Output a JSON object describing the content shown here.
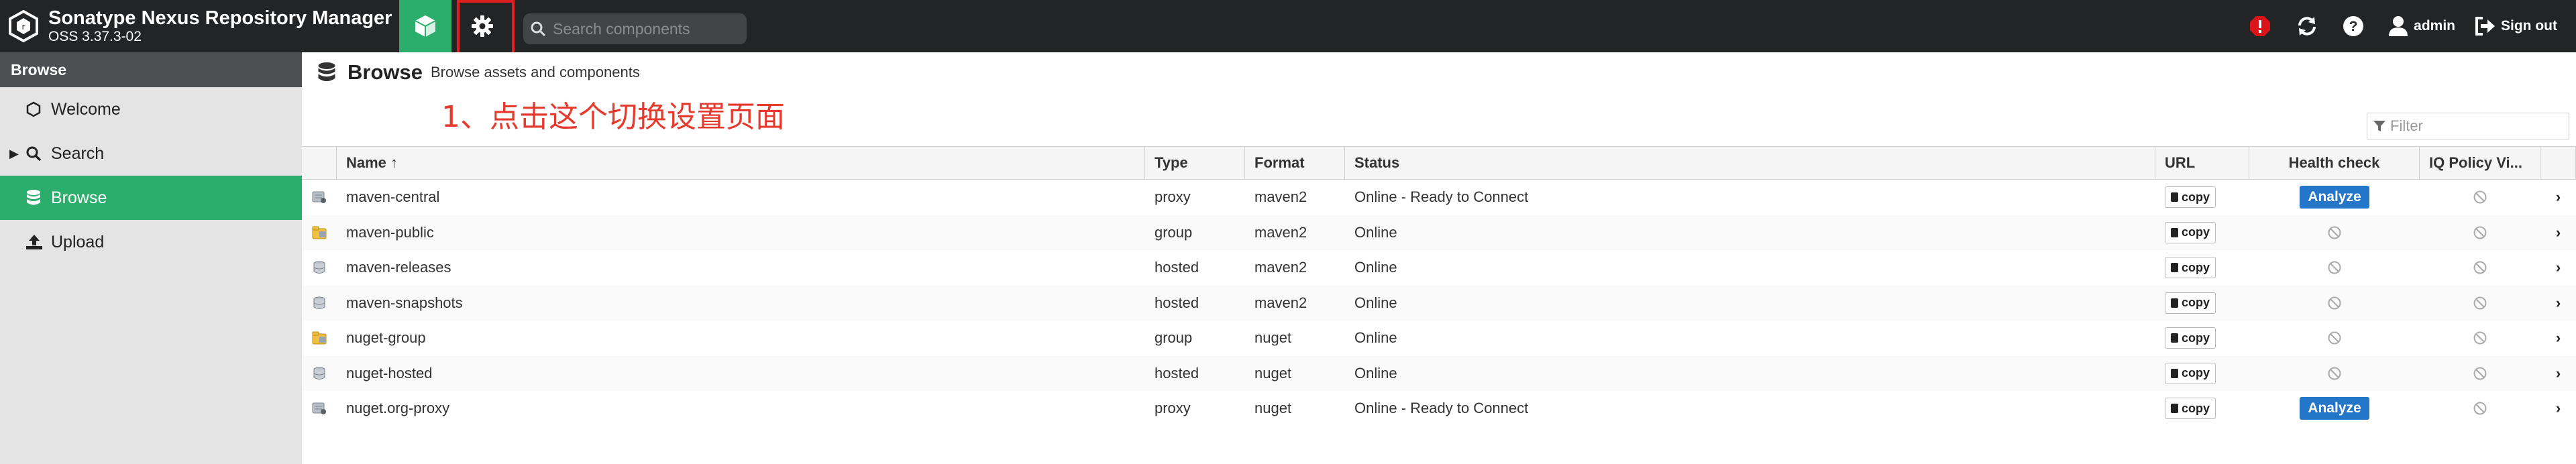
{
  "header": {
    "app_title": "Sonatype Nexus Repository Manager",
    "version": "OSS 3.37.3-02",
    "search_placeholder": "Search components",
    "user_name": "admin",
    "sign_out_label": "Sign out"
  },
  "annotation": "1、点击这个切换设置页面",
  "sidebar": {
    "header": "Browse",
    "items": [
      {
        "label": "Welcome",
        "icon": "hexagon-icon"
      },
      {
        "label": "Search",
        "icon": "search-icon"
      },
      {
        "label": "Browse",
        "icon": "database-icon",
        "active": true
      },
      {
        "label": "Upload",
        "icon": "upload-icon"
      }
    ]
  },
  "main": {
    "title": "Browse",
    "subtitle": "Browse assets and components",
    "filter_placeholder": "Filter",
    "columns": {
      "name": "Name ↑",
      "type": "Type",
      "format": "Format",
      "status": "Status",
      "url": "URL",
      "health": "Health check",
      "iq": "IQ Policy Vi..."
    },
    "copy_label": "copy",
    "analyze_label": "Analyze",
    "rows": [
      {
        "name": "maven-central",
        "type": "proxy",
        "format": "maven2",
        "status": "Online - Ready to Connect",
        "health": "analyze",
        "repo_icon": "proxy-repo-icon"
      },
      {
        "name": "maven-public",
        "type": "group",
        "format": "maven2",
        "status": "Online",
        "health": "disabled",
        "repo_icon": "group-repo-icon"
      },
      {
        "name": "maven-releases",
        "type": "hosted",
        "format": "maven2",
        "status": "Online",
        "health": "disabled",
        "repo_icon": "hosted-repo-icon"
      },
      {
        "name": "maven-snapshots",
        "type": "hosted",
        "format": "maven2",
        "status": "Online",
        "health": "disabled",
        "repo_icon": "hosted-repo-icon"
      },
      {
        "name": "nuget-group",
        "type": "group",
        "format": "nuget",
        "status": "Online",
        "health": "disabled",
        "repo_icon": "group-repo-icon"
      },
      {
        "name": "nuget-hosted",
        "type": "hosted",
        "format": "nuget",
        "status": "Online",
        "health": "disabled",
        "repo_icon": "hosted-repo-icon"
      },
      {
        "name": "nuget.org-proxy",
        "type": "proxy",
        "format": "nuget",
        "status": "Online - Ready to Connect",
        "health": "analyze",
        "repo_icon": "proxy-repo-icon"
      }
    ]
  },
  "colors": {
    "topbar": "#222426",
    "accent_green": "#2bae6b",
    "analyze_blue": "#2476c8",
    "annotation_red": "#e63a2e"
  }
}
